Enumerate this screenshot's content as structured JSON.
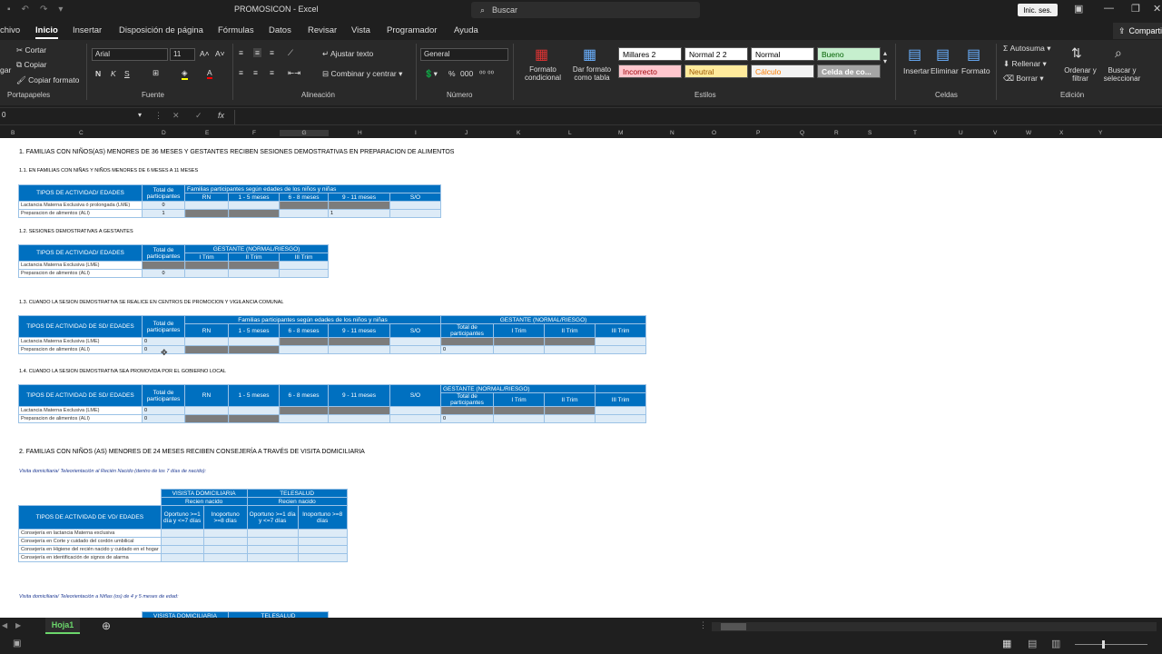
{
  "app": {
    "title": "PROMOSICON  -  Excel",
    "search_placeholder": "Buscar",
    "signin": "Inic. ses.",
    "share": "Compartir"
  },
  "menu": [
    "chivo",
    "Inicio",
    "Insertar",
    "Disposición de página",
    "Fórmulas",
    "Datos",
    "Revisar",
    "Vista",
    "Programador",
    "Ayuda"
  ],
  "ribbon": {
    "clipboard": {
      "cut": "Cortar",
      "copy": "Copiar",
      "format_painter": "Copiar formato",
      "paste": "gar",
      "label": "Portapapeles"
    },
    "font": {
      "name": "Arial",
      "size": "11",
      "label": "Fuente",
      "bold": "N",
      "italic": "K",
      "underline": "S"
    },
    "alignment": {
      "wrap": "Ajustar texto",
      "merge": "Combinar y centrar",
      "label": "Alineación"
    },
    "number": {
      "format": "General",
      "label": "Número",
      "pct": "%",
      "sep": "000"
    },
    "styles": {
      "cond": "Formato condicional",
      "table": "Dar formato como tabla",
      "label": "Estilos",
      "cells": [
        {
          "name": "Millares 2",
          "bg": "#ffffff",
          "fg": "#000000"
        },
        {
          "name": "Normal 2 2",
          "bg": "#ffffff",
          "fg": "#000000"
        },
        {
          "name": "Normal",
          "bg": "#ffffff",
          "fg": "#000000"
        },
        {
          "name": "Bueno",
          "bg": "#c6efce",
          "fg": "#006100"
        },
        {
          "name": "Incorrecto",
          "bg": "#ffc7ce",
          "fg": "#9c0006"
        },
        {
          "name": "Neutral",
          "bg": "#ffeb9c",
          "fg": "#9c5700"
        },
        {
          "name": "Cálculo",
          "bg": "#f2f2f2",
          "fg": "#fa7d00"
        },
        {
          "name": "Celda de co...",
          "bg": "#a5a5a5",
          "fg": "#ffffff"
        }
      ]
    },
    "cells": {
      "insert": "Insertar",
      "delete": "Eliminar",
      "format": "Formato",
      "label": "Celdas"
    },
    "editing": {
      "autosum": "Autosuma",
      "fill": "Rellenar",
      "clear": "Borrar",
      "sort": "Ordenar y filtrar",
      "find": "Buscar y seleccionar",
      "label": "Edición"
    }
  },
  "formula": {
    "namebox": "0",
    "fx": "fx"
  },
  "columns": [
    "B",
    "C",
    "D",
    "E",
    "F",
    "G",
    "H",
    "I",
    "J",
    "K",
    "L",
    "M",
    "N",
    "O",
    "P",
    "Q",
    "R",
    "S",
    "T",
    "U",
    "V",
    "W",
    "X",
    "Y"
  ],
  "sheet": {
    "s1_title": "1. FAMILIAS CON NIÑOS(AS) MENORES DE 36 MESES Y GESTANTES RECIBEN SESIONES DEMOSTRATIVAS EN PREPARACION DE ALIMENTOS",
    "s11": "1.1. EN FAMILIAS CON NIÑAS Y NIÑOS MENORES DE 6 MESES A 11 MESES",
    "s12": "1.2. SESIONES DEMOSTRATIVAS A GESTANTES",
    "s13": "1.3. CUANDO LA SESION DEMOSTRATIVA SE REALICE EN CENTROS DE PROMOCION Y VIGILANCIA COMUNAL",
    "s14": "1.4. CUANDO LA SESION DEMOSTRATIVA SEA PROMOVIDA POR EL GOBIERNO LOCAL",
    "s2_title": "2.  FAMILIAS CON NIÑOS (AS) MENORES DE 24 MESES RECIBEN CONSEJERÍA A TRAVÉS DE VISITA DOMICILIARIA",
    "s2_sub": "Visita domiciliaria/ Teleorientación al Recién Nacido (dentro de los 7 días de nacido):",
    "s2_sub2": "Visita domiciliaria/ Teleorientación  a Niñas (os) de 4 y 5 meses de edad:",
    "h_tipos": "TIPOS DE ACTIVIDAD/ EDADES",
    "h_tipos_sd": "TIPOS DE ACTIVIDAD DE SD/ EDADES",
    "h_tipos_vd": "TIPOS DE ACTIVIDAD DE VD/ EDADES",
    "h_total": "Total de participantes",
    "h_familias": "Familias participantes según edades de los niños y niñas",
    "h_gestante": "GESTANTE (NORMAL/RIESGO)",
    "ages": [
      "RN",
      "1 - 5 meses",
      "6 - 8 meses",
      "9 - 11 meses",
      "S/O"
    ],
    "trims": [
      "I Trim",
      "II Trim",
      "III Trim"
    ],
    "row_lme": "Lactancia Materna Exclusiva ó prolongada (LME)",
    "row_lme2": "Lactancia Materna Exclusiva (LME)",
    "row_ali": "Preparacion de alimentos (ALI)",
    "v0": "0",
    "v1": "1",
    "vd": "VISISTA DOMICILIARIA",
    "tele": "TELESALUD",
    "rn": "Recien nacido",
    "opo": "Oportuno >=1 día y <=7 días",
    "ino": "Inoportuno >=8 días",
    "cons": [
      "Consejería en lactancia Materna exclusiva",
      "Consejería en Corte y cuidado del cordón umbilical",
      "Consejería en Higiene del recién nacido y cuidado en el hogar",
      "Consejería en identificación de signos de alarma"
    ]
  },
  "sheet_tab": "Hoja1"
}
